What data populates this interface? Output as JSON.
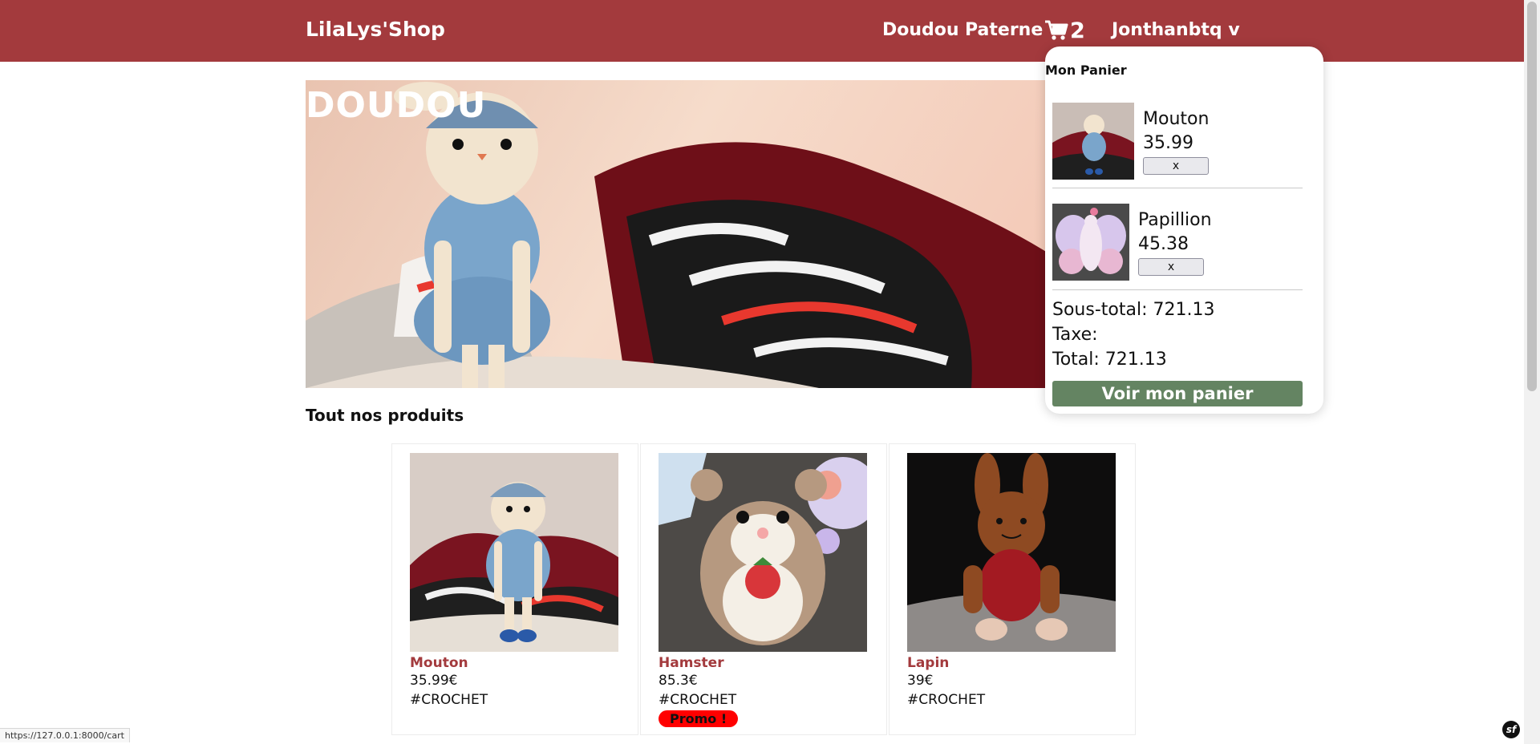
{
  "header": {
    "brand": "LilaLys'Shop",
    "nav": [
      "Doudou",
      "Paterne"
    ],
    "cart_count": "2",
    "user": "Jonthanbtq v"
  },
  "hero": {
    "title": "DOUDOU"
  },
  "section_title": "Tout nos produits",
  "products": [
    {
      "name": "Mouton",
      "price": "35.99€",
      "tag": "#CROCHET"
    },
    {
      "name": "Hamster",
      "price": "85.3€",
      "tag": "#CROCHET",
      "badge": "Promo !"
    },
    {
      "name": "Lapin",
      "price": "39€",
      "tag": "#CROCHET"
    }
  ],
  "cart_popup": {
    "title": "Mon Panier",
    "items": [
      {
        "name": "Mouton",
        "price": "35.99",
        "remove_label": "x"
      },
      {
        "name": "Papillion",
        "price": "45.38",
        "remove_label": "x"
      }
    ],
    "subtotal": "Sous-total: 721.13",
    "tax": "Taxe:",
    "total": "Total: 721.13",
    "cta": "Voir mon panier"
  },
  "status_url": "https://127.0.0.1:8000/cart",
  "colors": {
    "header": "#a33a3d",
    "accent_text": "#a33a3d",
    "cta": "#648462",
    "promo": "#ff0000"
  },
  "icons": {
    "cart": "cart-icon",
    "symfony": "symfony-icon"
  }
}
